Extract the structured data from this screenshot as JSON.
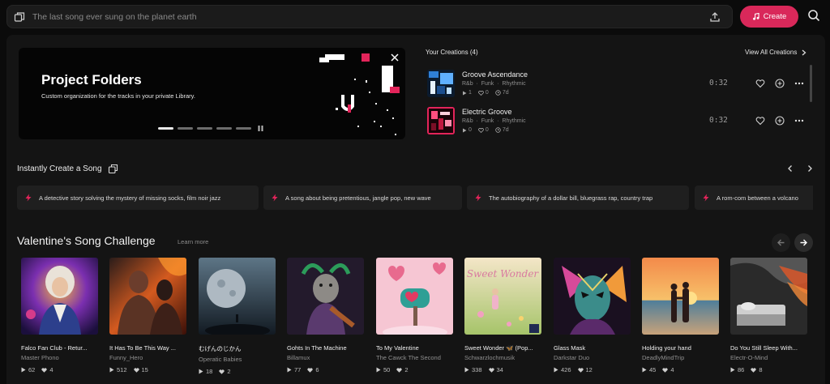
{
  "search": {
    "placeholder": "The last song ever sung on the planet earth"
  },
  "create_label": "Create",
  "banner": {
    "title": "Project Folders",
    "subtitle": "Custom organization for the tracks in your private Library.",
    "slide_count": 5,
    "active_slide": 1
  },
  "creations": {
    "title": "Your Creations (4)",
    "view_all": "View All Creations",
    "items": [
      {
        "title": "Groove Ascendance",
        "tags": [
          "R&b",
          "Funk",
          "Rhythmic"
        ],
        "plays": "1",
        "likes": "0",
        "age": "7d",
        "duration": "0:32"
      },
      {
        "title": "Electric Groove",
        "tags": [
          "R&b",
          "Funk",
          "Rhythmic"
        ],
        "plays": "0",
        "likes": "0",
        "age": "7d",
        "duration": "0:32"
      }
    ]
  },
  "instant": {
    "title": "Instantly Create a Song",
    "prompts": [
      "A detective story solving the mystery of missing socks, film noir jazz",
      "A song about being pretentious, jangle pop, new wave",
      "The autobiography of a dollar bill, bluegrass rap, country trap",
      "A rom-com between a volcano"
    ]
  },
  "challenge": {
    "title": "Valentine's Song Challenge",
    "learn_more": "Learn more",
    "songs": [
      {
        "title": "Falco Fan Club - Retur...",
        "artist": "Master Phono",
        "plays": "62",
        "likes": "4"
      },
      {
        "title": "It Has To Be This Way ...",
        "artist": "Funny_Hero",
        "plays": "512",
        "likes": "15"
      },
      {
        "title": "むげんのじかん",
        "artist": "Operatic Babies",
        "plays": "18",
        "likes": "2"
      },
      {
        "title": "Gohts In The Machine",
        "artist": "Billamux",
        "plays": "77",
        "likes": "6"
      },
      {
        "title": "To My Valentine",
        "artist": "The Cawck The Second",
        "plays": "50",
        "likes": "2"
      },
      {
        "title": "Sweet Wonder 🦋 (Pop...",
        "artist": "Schwarzlochmusik",
        "plays": "338",
        "likes": "34",
        "cover_text": "Sweet Wonder"
      },
      {
        "title": "Glass Mask",
        "artist": "Darkstar Duo",
        "plays": "426",
        "likes": "12"
      },
      {
        "title": "Holding your hand",
        "artist": "DeadlyMindTrip",
        "plays": "45",
        "likes": "4"
      },
      {
        "title": "Do You Still Sleep With...",
        "artist": "Electr-O-Mind",
        "plays": "86",
        "likes": "8"
      }
    ]
  },
  "colors": {
    "accent": "#d9285a",
    "background": "#0b0b0b",
    "panel": "#141414"
  }
}
